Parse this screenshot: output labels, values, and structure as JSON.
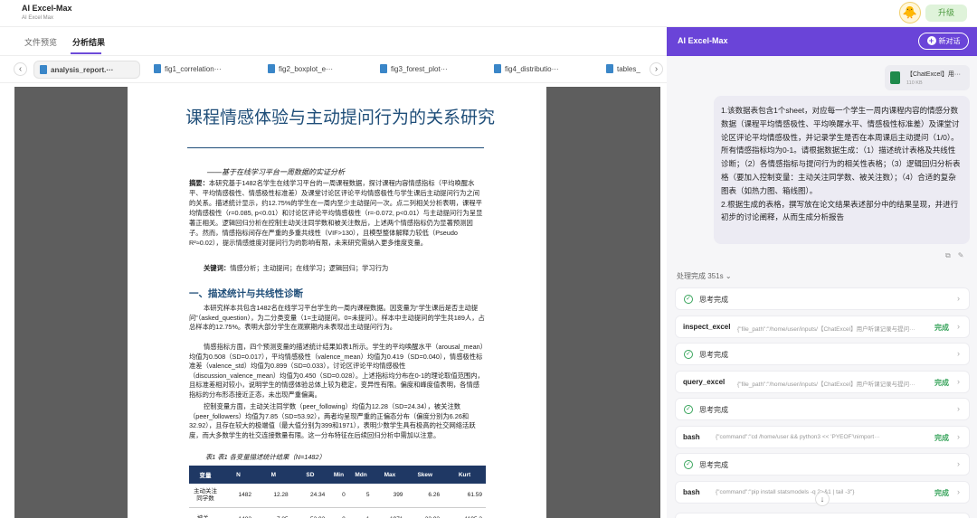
{
  "app": {
    "title": "AI Excel-Max",
    "subtitle": "AI Excel Max",
    "upgrade": "升级"
  },
  "left_tabs": [
    "文件预览",
    "分析结果"
  ],
  "files": [
    "analysis_report.···",
    "fig1_correlation···",
    "fig2_boxplot_e···",
    "fig3_forest_plot···",
    "fig4_distributio···",
    "tables_"
  ],
  "nav": {
    "prev": "‹",
    "next": "›"
  },
  "doc": {
    "title": "课程情感体验与主动提问行为的关系研究",
    "subtitle": "——基于在线学习平台一周数据的实证分析",
    "abstract_label": "摘要：",
    "abstract": "本研究基于1482名学生在线学习平台的一周课程数据，探讨课程内容情感指标（平均唤醒水平、平均情感极性、情感极性标准差）及课堂讨论区评论平均情感极性与学生课后主动提问行为之间的关系。描述统计显示，约12.75%的学生在一周内至少主动提问一次。点二列相关分析表明，课程平均情感极性（r=0.085, p<0.01）和讨论区评论平均情感极性（r=-0.072, p<0.01）与主动提问行为呈显著正相关。逻辑回归分析在控制主动关注同学数和被关注数后，上述两个情感指标仍为显著预测因子。然而，情感指标间存在严重的多重共线性（VIF>130），且模型整体解释力较低（Pseudo R²≈0.02），提示情感维度对提问行为的影响有限，未来研究需纳入更多维度变量。",
    "keywords_label": "关键词：",
    "keywords": "情感分析；主动提问；在线学习；逻辑回归；学习行为",
    "section1": "一、描述统计与共线性诊断",
    "para1": "本研究样本共包含1482名在线学习平台学生的一周内课程数据。因变量为“学生课后是否主动提问”（asked_question），为二分类变量（1=主动提问，0=未提问）。样本中主动提问的学生共189人，占总样本的12.75%。表明大部分学生在观察期内未表现出主动提问行为。",
    "para2": "情感指标方面，四个预测变量的描述统计结果如表1所示。学生的平均唤醒水平（arousal_mean）均值为0.508（SD=0.017），平均情感极性（valence_mean）均值为0.419（SD=0.040），情感极性标准差（valence_std）均值为0.899（SD=0.033），讨论区评论平均情感极性（discussion_valence_mean）均值为0.450（SD=0.028）。上述指标均分布在0-1的理论取值范围内，且标准差相对较小，说明学生的情感体验总体上较为稳定，变异性有限。偏度和峰度值表明，各情感指标的分布形态接近正态，未出现严重偏离。",
    "para3": "控制变量方面，主动关注同学数（peer_following）均值为12.28（SD=24.34），被关注数（peer_followers）均值为7.85（SD=53.92），两者均呈现严重的正偏态分布（偏度分别为6.26和32.92），且存在较大的极端值（最大值分别为399和1971），表明少数学生具有极高的社交网络活跃度，而大多数学生的社交连接数量有限。这一分布特征在后续回归分析中需加以注意。",
    "caption": "表1   表1 各变量描述统计结果（N=1482）",
    "table_headers": [
      "变量",
      "N",
      "M",
      "SD",
      "Min",
      "Mdn",
      "Max",
      "Skew",
      "Kurt"
    ],
    "table_rows": [
      [
        "主动关注同学数",
        "1482",
        "12.28",
        "24.34",
        "0",
        "5",
        "399",
        "6.26",
        "61.59"
      ],
      [
        "被关...",
        "1482",
        "7.85",
        "53.92",
        "0",
        "1",
        "1971",
        "32.92",
        "1195.3"
      ]
    ]
  },
  "chat": {
    "title": "AI Excel-Max",
    "new_chat": "新对话",
    "file_name": "【ChatExcel】用···",
    "file_size": "110 KB",
    "message": [
      "1.该数据表包含1个sheet，对应每一个学生一周内课程内容的情感分数数据（课程平均情感极性、平均唤醒水平、情感极性标准差）及课堂讨论区评论平均情感极性，并记录学生是否在本周课后主动提问（1/0）。所有情感指标均为0-1。请根据数据生成：（1）描述统计表格及共线性诊断；（2）各情感指标与提问行为的相关性表格；（3）逻辑回归分析表格（要加入控制变量：主动关注同学数、被关注数）；（4）合适的复杂图表（如热力图、箱线图）。",
      "2.根据生成的表格，撰写放在论文结果表述部分中的结果呈现，并进行初步的讨论阐释，从而生成分析报告"
    ],
    "process": "处理完成 351s",
    "steps": [
      {
        "type": "think",
        "label": "思考完成"
      },
      {
        "type": "tool",
        "name": "inspect_excel",
        "args": "{\"file_path\":\"/home/user/inputs/【ChatExcel】用户听课记录与提问···",
        "status": "完成"
      },
      {
        "type": "think",
        "label": "思考完成"
      },
      {
        "type": "tool",
        "name": "query_excel",
        "args": "{\"file_path\":\"/home/user/inputs/【ChatExcel】用户听课记录与提问···",
        "status": "完成"
      },
      {
        "type": "think",
        "label": "思考完成"
      },
      {
        "type": "tool",
        "name": "bash",
        "args": "{\"command\":\"cd /home/user && python3 << 'PYEOF'\\nimport···",
        "status": "完成"
      },
      {
        "type": "think",
        "label": "思考完成"
      },
      {
        "type": "tool",
        "name": "bash",
        "args": "{\"command\":\"pip install statsmodels -q 2>&1 | tail -3\"}",
        "status": "完成"
      }
    ]
  },
  "colors": {
    "accent": "#6a44d8",
    "doc_blue": "#1f4e79",
    "table_header": "#1f3864",
    "success": "#3aa55d"
  }
}
